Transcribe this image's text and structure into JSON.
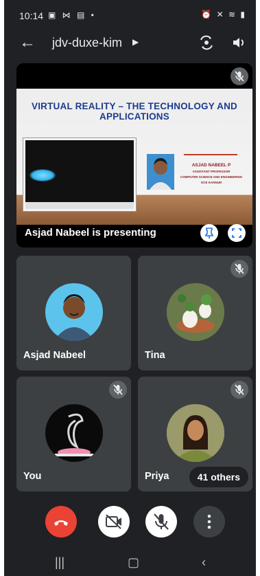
{
  "status_bar": {
    "time": "10:14",
    "left_icons": "▣ ⋈ ▤ •",
    "right_icons": "⏰ ✕ ≋ ▮"
  },
  "header": {
    "meeting_code": "jdv-duxe-kim"
  },
  "presentation": {
    "slide_title": "VIRTUAL REALITY – THE TECHNOLOGY AND APPLICATIONS",
    "slide_name": "ASJAD NABEEL P",
    "slide_role": "ASSISTANT PROFESSOR",
    "slide_dept": "COMPUTER SCIENCE AND ENGINEERING",
    "slide_college": "GCE KANNUR",
    "label": "Asjad Nabeel is presenting"
  },
  "participants": [
    {
      "name": "Asjad Nabeel",
      "muted": false
    },
    {
      "name": "Tina",
      "muted": true
    },
    {
      "name": "You",
      "muted": true
    },
    {
      "name": "Priya",
      "muted": true,
      "others_label": "41 others"
    }
  ],
  "colors": {
    "background": "#202124",
    "tile": "#3c4043",
    "end_call": "#ea4335",
    "slide_title": "#1b3b8f"
  },
  "icons": [
    "back-arrow-icon",
    "switch-camera-icon",
    "volume-icon",
    "mic-off-icon",
    "pin-icon",
    "fullscreen-icon",
    "end-call-icon",
    "camera-off-icon",
    "more-icon"
  ]
}
